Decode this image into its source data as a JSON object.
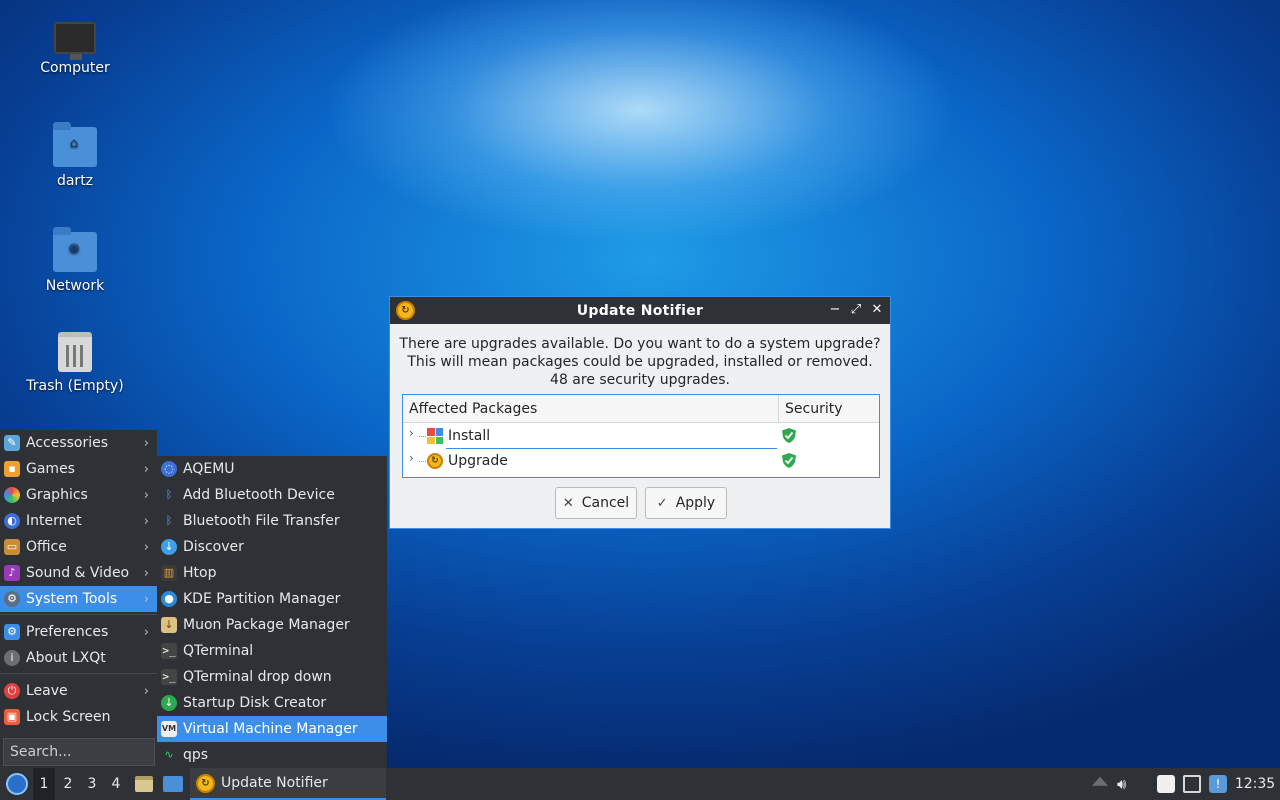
{
  "desktop": {
    "icons": [
      {
        "label": "Computer",
        "icon": "computer-icon"
      },
      {
        "label": "dartz",
        "icon": "home-folder-icon"
      },
      {
        "label": "Network",
        "icon": "network-folder-icon"
      },
      {
        "label": "Trash (Empty)",
        "icon": "trash-icon"
      }
    ]
  },
  "menu": {
    "categories": [
      {
        "label": "Accessories",
        "icon": "accessories-icon",
        "has_submenu": true
      },
      {
        "label": "Games",
        "icon": "games-icon",
        "has_submenu": true
      },
      {
        "label": "Graphics",
        "icon": "graphics-icon",
        "has_submenu": true
      },
      {
        "label": "Internet",
        "icon": "internet-icon",
        "has_submenu": true
      },
      {
        "label": "Office",
        "icon": "office-icon",
        "has_submenu": true
      },
      {
        "label": "Sound & Video",
        "icon": "sound-video-icon",
        "has_submenu": true
      },
      {
        "label": "System Tools",
        "icon": "system-tools-icon",
        "has_submenu": true,
        "selected": true
      },
      {
        "label": "Preferences",
        "icon": "preferences-icon",
        "has_submenu": true
      },
      {
        "label": "About LXQt",
        "icon": "about-icon",
        "has_submenu": false
      },
      {
        "label": "Leave",
        "icon": "leave-icon",
        "has_submenu": true
      },
      {
        "label": "Lock Screen",
        "icon": "lock-icon",
        "has_submenu": false
      }
    ],
    "search_placeholder": "Search...",
    "arrow": "›",
    "submenu_items": [
      {
        "label": "AQEMU",
        "icon": "aqemu-icon"
      },
      {
        "label": "Add Bluetooth Device",
        "icon": "bluetooth-icon"
      },
      {
        "label": "Bluetooth File Transfer",
        "icon": "bluetooth-icon"
      },
      {
        "label": "Discover",
        "icon": "discover-icon"
      },
      {
        "label": "Htop",
        "icon": "htop-icon"
      },
      {
        "label": "KDE Partition Manager",
        "icon": "partition-manager-icon"
      },
      {
        "label": "Muon Package Manager",
        "icon": "muon-icon"
      },
      {
        "label": "QTerminal",
        "icon": "terminal-icon"
      },
      {
        "label": "QTerminal drop down",
        "icon": "terminal-icon"
      },
      {
        "label": "Startup Disk Creator",
        "icon": "startup-disk-icon"
      },
      {
        "label": "Virtual Machine Manager",
        "icon": "virt-manager-icon",
        "selected": true
      },
      {
        "label": "qps",
        "icon": "qps-icon"
      }
    ]
  },
  "dialog": {
    "title": "Update Notifier",
    "message_line1": "There are upgrades available. Do you want to do a system upgrade?",
    "message_line2": "This will mean packages could be upgraded, installed or removed.",
    "message_line3": "48 are security upgrades.",
    "columns": {
      "packages": "Affected Packages",
      "security": "Security"
    },
    "rows": [
      {
        "label": "Install",
        "icon": "install-icon",
        "security": "shield-check-icon"
      },
      {
        "label": "Upgrade",
        "icon": "upgrade-icon",
        "security": "shield-check-icon"
      }
    ],
    "cancel_label": "Cancel",
    "apply_label": "Apply",
    "window_buttons": {
      "minimize": "−",
      "maximize": "⤢",
      "close": "✕"
    }
  },
  "taskbar": {
    "workspaces": [
      "1",
      "2",
      "3",
      "4"
    ],
    "active_workspace": "1",
    "task_label": "Update Notifier",
    "clock": "12:35"
  },
  "colors": {
    "accent": "#3d8ee8",
    "panel": "#2e3136",
    "shield_green": "#2fa84f"
  }
}
